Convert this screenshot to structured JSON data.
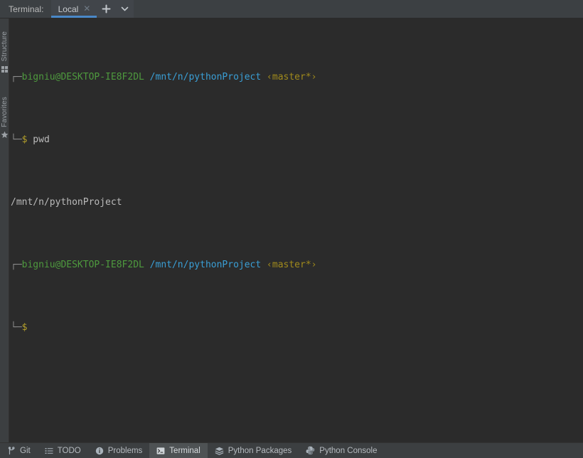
{
  "header": {
    "label": "Terminal:",
    "tabs": [
      {
        "label": "Local",
        "close_icon": "close-icon",
        "active": true
      }
    ],
    "add_icon": "plus-icon",
    "dropdown_icon": "chevron-down-icon"
  },
  "leftbar": {
    "items": [
      {
        "label": "Structure",
        "icon": "structure-grid-icon"
      },
      {
        "label": "Favorites",
        "icon": "star-icon"
      }
    ]
  },
  "terminal": {
    "lines": [
      {
        "type": "prompt-top",
        "gutter": "┌─",
        "user": "bigniu@DESKTOP-IE8F2DL",
        "path": "/mnt/n/pythonProject",
        "branch": "‹master*›"
      },
      {
        "type": "prompt-cmd",
        "gutter": "└─",
        "dollar": "$",
        "command": " pwd"
      },
      {
        "type": "output",
        "text": "/mnt/n/pythonProject"
      },
      {
        "type": "prompt-top",
        "gutter": "┌─",
        "user": "bigniu@DESKTOP-IE8F2DL",
        "path": "/mnt/n/pythonProject",
        "branch": "‹master*›"
      },
      {
        "type": "prompt-cmd",
        "gutter": "└─",
        "dollar": "$",
        "command": ""
      }
    ],
    "colors": {
      "background": "#2b2b2b",
      "user": "#4e9a3e",
      "path": "#3a9fd6",
      "branch": "#a08a1c",
      "dollar": "#b5a12a",
      "output": "#bbbbbb"
    }
  },
  "statusbar": {
    "items": [
      {
        "label": "Git",
        "icon": "git-branch-icon",
        "active": false
      },
      {
        "label": "TODO",
        "icon": "todo-list-icon",
        "active": false
      },
      {
        "label": "Problems",
        "icon": "info-circle-icon",
        "active": false
      },
      {
        "label": "Terminal",
        "icon": "terminal-icon",
        "active": true
      },
      {
        "label": "Python Packages",
        "icon": "packages-layers-icon",
        "active": false
      },
      {
        "label": "Python Console",
        "icon": "python-icon",
        "active": false
      }
    ],
    "accent": "#4e5254"
  }
}
